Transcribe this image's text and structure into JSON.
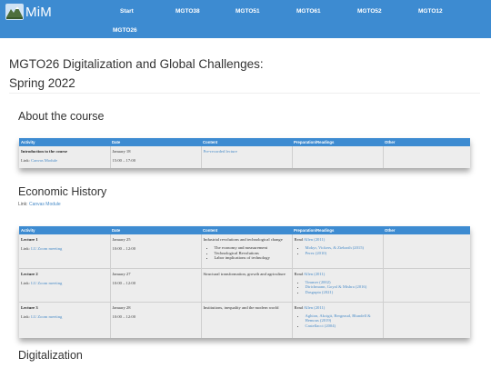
{
  "nav": {
    "brand": "MiM",
    "links": [
      "Start",
      "MGTO38",
      "MGTO51",
      "MGTO61",
      "MGTO52",
      "MGTO12",
      "MGTO26"
    ]
  },
  "page": {
    "title_line1": "MGTO26 Digitalization and Global Challenges:",
    "title_line2": "Spring 2022"
  },
  "about": {
    "heading": "About the course",
    "headers": [
      "Activity",
      "Date",
      "Content",
      "Preparation/Readings",
      "Other"
    ],
    "row": {
      "activity": "Introduction to the course",
      "link_prefix": "Link:",
      "link_text": "Canvas Module",
      "date": "January 18",
      "time": "15:00 – 17:00",
      "content": "Pre-recorded lecture"
    }
  },
  "econ": {
    "heading": "Economic History",
    "link_prefix": "Link:",
    "link_text": "Canvas Module",
    "headers": [
      "Activity",
      "Date",
      "Content",
      "Preparation/Readings",
      "Other"
    ],
    "rows": [
      {
        "name": "Lecture 1",
        "link_prefix": "Link:",
        "link_text": "LU Zoom meeting",
        "date": "January 25",
        "time": "10:00 – 12:00",
        "content": "Industrial revolutions and technological change",
        "read_prefix": "Read",
        "read_link": "Allen (2011)",
        "bullets": [
          "The economy and measurement",
          "Technological Revolutions",
          "Labor implications of technology"
        ],
        "refs": [
          "Mokyr, Vickers, & Ziebarth (2015)",
          "Perez (2010)"
        ]
      },
      {
        "name": "Lecture 2",
        "link_prefix": "Link:",
        "link_text": "LU Zoom meeting",
        "date": "January 27",
        "time": "10:00 – 12:00",
        "content": "Structural transformation, growth and agriculture",
        "read_prefix": "Read",
        "read_link": "Allen (2011)",
        "bullets": [],
        "refs": [
          "Timmer (2002)",
          "Dirichmann, Goyal & Mishra (2016)",
          "Dasgupta (2021)"
        ]
      },
      {
        "name": "Lecture 3",
        "link_prefix": "Link:",
        "link_text": "LU Zoom meeting",
        "date": "January 28",
        "time": "10:00 – 12:00",
        "content": "Institutions, inequality and the modern world",
        "read_prefix": "Read",
        "read_link": "Allen (2011)",
        "bullets": [],
        "refs": [
          "Aghion, Akcigit, Bergeaud, Blundell & Hemous (2019)",
          "Castellacci (2004)"
        ]
      }
    ]
  },
  "digital": {
    "heading": "Digitalization"
  },
  "colors": {
    "nav_bg": "#3d8bd1",
    "link": "#4a8cc8",
    "table_row_bg": "#ededed"
  },
  "icons": {
    "brand": "mountain-logo-icon"
  }
}
